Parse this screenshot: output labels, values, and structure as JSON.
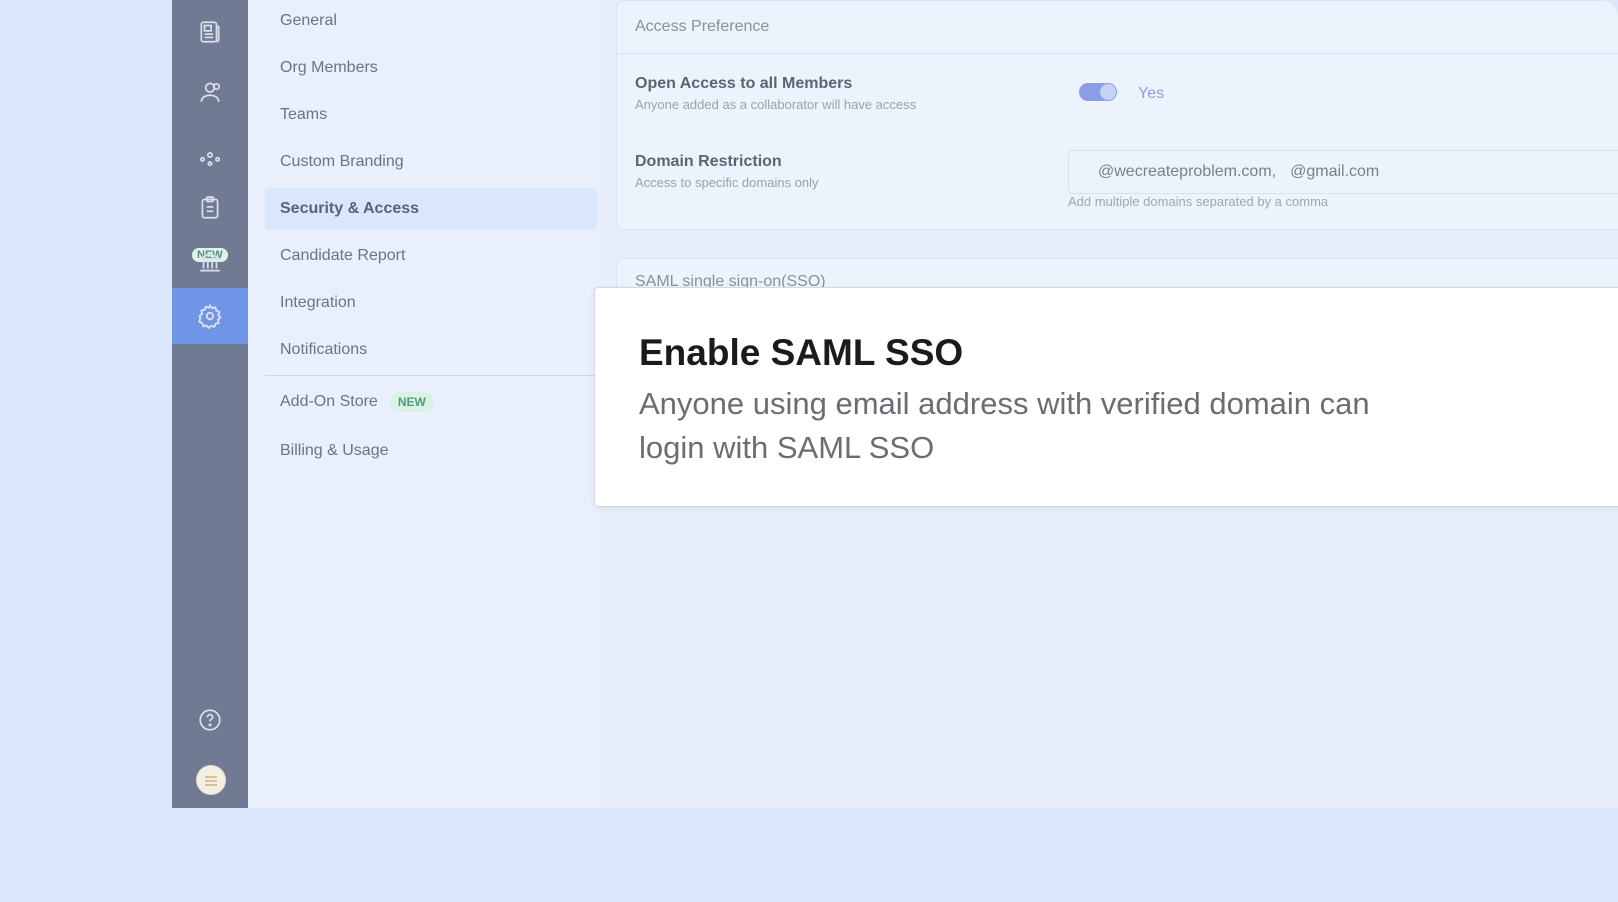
{
  "rail": {
    "items": [
      {
        "icon": "document-icon"
      },
      {
        "icon": "users-icon"
      },
      {
        "icon": "network-icon",
        "badge": "NEW"
      },
      {
        "icon": "clipboard-icon"
      },
      {
        "icon": "bank-icon"
      },
      {
        "icon": "gear-icon",
        "active": true
      },
      {
        "icon": "help-icon"
      },
      {
        "icon": "avatar"
      }
    ]
  },
  "settings_menu": {
    "items": [
      {
        "label": "General"
      },
      {
        "label": "Org Members"
      },
      {
        "label": "Teams"
      },
      {
        "label": "Custom Branding"
      },
      {
        "label": "Security & Access",
        "active": true
      },
      {
        "label": "Candidate Report"
      },
      {
        "label": "Integration"
      },
      {
        "label": "Notifications"
      },
      {
        "label": "Add-On Store",
        "badge": "NEW"
      },
      {
        "label": "Billing & Usage"
      }
    ]
  },
  "access_preference": {
    "header": "Access Preference",
    "open_access": {
      "title": "Open Access to all Members",
      "description": "Anyone added as a collaborator will have access",
      "toggle_label": "Yes",
      "enabled": true
    },
    "domain_restriction": {
      "title": "Domain Restriction",
      "description": "Access to specific domains only",
      "domains": [
        "@wecreateproblem.com,",
        "@gmail.com"
      ],
      "hint": "Add multiple domains separated by a comma"
    }
  },
  "saml_card": {
    "title": "SAML single sign-on(SSO)"
  },
  "callout": {
    "title": "Enable SAML SSO",
    "body": "Anyone using email address with verified domain can login with SAML SSO"
  },
  "colors": {
    "rail": "#707b93",
    "rail_active": "#6f96e6",
    "accent_toggle": "#8a9de6",
    "new_badge": "#4e9c79"
  }
}
